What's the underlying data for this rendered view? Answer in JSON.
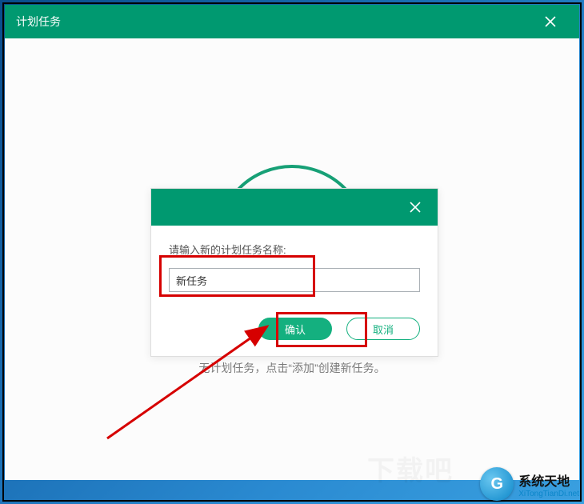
{
  "main": {
    "title": "计划任务",
    "empty_text": "无计划任务，点击“添加”创建新任务。"
  },
  "dialog": {
    "label": "请输入新的计划任务名称:",
    "input_value": "新任务",
    "confirm_label": "确认",
    "cancel_label": "取消"
  },
  "watermark": {
    "glyph": "G",
    "line1": "系统天地",
    "line2": "XiTongTianDi.net",
    "faint": "下载吧"
  }
}
